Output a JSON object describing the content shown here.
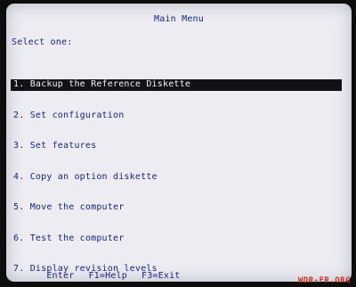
{
  "header": {
    "title": "Main Menu"
  },
  "prompt": "Select one:",
  "menu": {
    "items": [
      {
        "number": "1.",
        "label": "Backup the Reference Diskette",
        "selected": true
      },
      {
        "number": "2.",
        "label": "Set configuration",
        "selected": false
      },
      {
        "number": "3.",
        "label": "Set features",
        "selected": false
      },
      {
        "number": "4.",
        "label": "Copy an option diskette",
        "selected": false
      },
      {
        "number": "5.",
        "label": "Move the computer",
        "selected": false
      },
      {
        "number": "6.",
        "label": "Test the computer",
        "selected": false
      },
      {
        "number": "7.",
        "label": "Display revision levels",
        "selected": false
      }
    ]
  },
  "footer": {
    "enter_label": "Enter",
    "f1_label": "F1=Help",
    "f3_label": "F3=Exit"
  },
  "watermark": "WDR-FR.ORG",
  "colors": {
    "screen_bg": "#ececf2",
    "text": "#1b2478",
    "highlight_bg": "#111218",
    "highlight_text": "#f4f4f8",
    "watermark": "#c8341e"
  }
}
